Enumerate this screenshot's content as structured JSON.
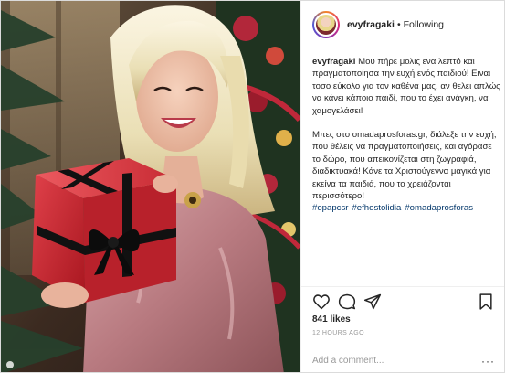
{
  "post": {
    "username": "evyfragaki",
    "separator": "•",
    "follow_state": "Following"
  },
  "caption": {
    "author": "evyfragaki",
    "paragraph1": "Μου πήρε μολις ενα λεπτό και πραγματοποίησα την ευχή ενός παιδιού! Ειναι τοσο εύκολο για τον καθένα μας, αν θελει απλώς να κάνει κάποιο παιδί, που το έχει ανάγκη, να χαμογελάσει!",
    "paragraph2": "Μπες στο omadaprosforas.gr, διάλεξε την ευχή, που θέλεις να πραγματοποιήσεις, και αγόρασε το δώρο, που απεικονίζεται στη ζωγραφιά, διαδικτυακά! Κάνε τα Χριστούγεννα μαγικά για εκείνα τα παιδιά, που το χρειάζονται περισσότερο!",
    "hashtags": [
      "#opapcsr",
      "#efhostolidia",
      "#omadaprosforas"
    ]
  },
  "engagement": {
    "likes": "841 likes",
    "timestamp": "12 HOURS AGO"
  },
  "comment": {
    "placeholder": "Add a comment...",
    "more": "···"
  },
  "icons": [
    "heart-icon",
    "comment-icon",
    "share-icon",
    "bookmark-icon"
  ],
  "colors": {
    "text": "#262626",
    "hashtag": "#003569",
    "muted": "#999999",
    "border": "#efefef",
    "gift_box": "#c8222f",
    "ribbon": "#111111",
    "velvet_top": "#c98f95"
  }
}
